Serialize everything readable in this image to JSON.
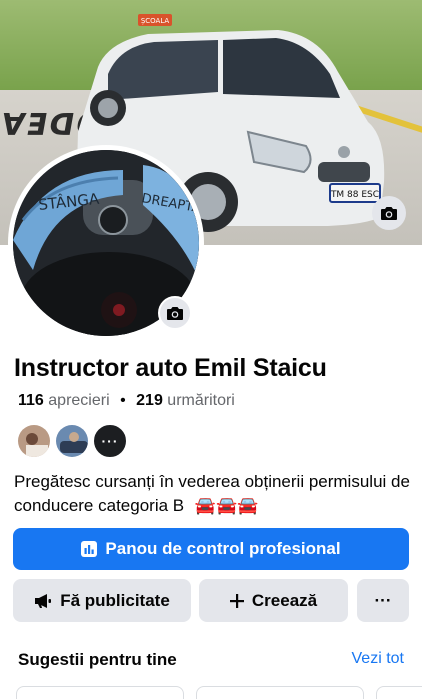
{
  "page": {
    "name": "Instructor auto Emil Staicu",
    "likes_count": "116",
    "likes_label": "aprecieri",
    "followers_count": "219",
    "followers_label": "urmăritori",
    "bio": "Pregătesc cursanți în vederea obținerii permisului de conducere categoria B",
    "bio_emoji": "🚘🚘🚘",
    "cover_text": "ODEA",
    "plate_text": "TM 88 ESC",
    "sign_text": "ȘCOALA",
    "glove_left_text": "STÂNGA",
    "glove_right_text": "DREAPTA"
  },
  "actions": {
    "dashboard_label": "Panou de control profesional",
    "advertise_label": "Fă publicitate",
    "create_label": "Creează",
    "more_label": "···"
  },
  "suggestions": {
    "title": "Sugestii pentru tine",
    "see_all": "Vezi tot"
  },
  "icons": {
    "cover_camera": "camera-icon",
    "avatar_camera": "camera-icon",
    "dashboard": "dashboard-icon",
    "advertise": "megaphone-icon",
    "create": "plus-icon",
    "more": "more-icon"
  },
  "colors": {
    "primary": "#1877f2",
    "secondary_button": "#e4e6eb",
    "text": "#050505",
    "muted": "#65676b"
  }
}
